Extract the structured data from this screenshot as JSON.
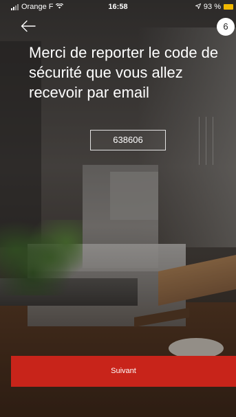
{
  "status_bar": {
    "carrier": "Orange F",
    "time": "16:58",
    "battery": "93 %",
    "icons": [
      "signal-icon",
      "wifi-icon",
      "location-icon",
      "battery-icon"
    ]
  },
  "header": {
    "back_icon": "arrow-left-icon",
    "badge": "6"
  },
  "main": {
    "title": "Merci de reporter le code de sécurité que vous allez recevoir par email",
    "code_value": "638606"
  },
  "footer": {
    "next_label": "Suivant"
  },
  "colors": {
    "accent": "#c8241a",
    "text": "#ffffff",
    "battery": "#f0b800"
  }
}
